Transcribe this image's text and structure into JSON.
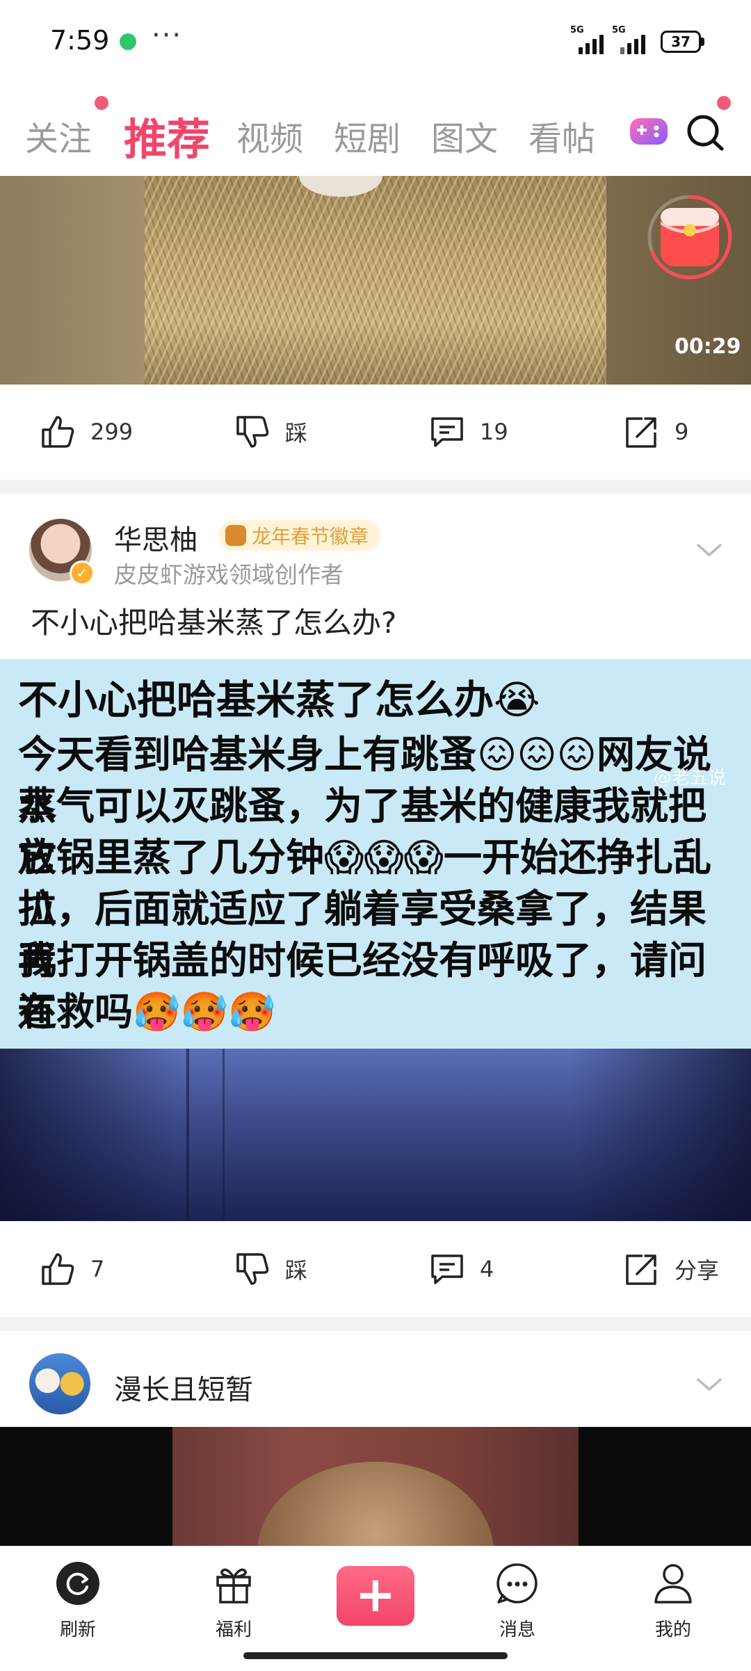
{
  "status_bar": {
    "time": "7:59",
    "more": "···",
    "net1": "5G",
    "net2": "5G",
    "battery": "37"
  },
  "tabs": [
    {
      "label": "关注"
    },
    {
      "label": "推荐"
    },
    {
      "label": "视频"
    },
    {
      "label": "短剧"
    },
    {
      "label": "图文"
    },
    {
      "label": "看帖"
    }
  ],
  "icons": {
    "game": "gamepad-icon",
    "search": "search-icon",
    "redpacket": "red-packet-icon"
  },
  "post1": {
    "video_duration": "00:29",
    "likes": "299",
    "dislike_label": "踩",
    "comments": "19",
    "shares": "9"
  },
  "post2": {
    "author": "华思柚",
    "badge": "龙年春节徽章",
    "author_desc": "皮皮虾游戏领域创作者",
    "title": "不小心把哈基米蒸了怎么办?",
    "image_title": "不小心把哈基米蒸了怎么办😭",
    "image_lines": [
      "今天看到哈基米身上有跳蚤😖😖😖网友说水",
      "蒸气可以灭跳蚤，为了基米的健康我就把它",
      "放锅里蒸了几分钟😱😱😱一开始还挣扎乱扒",
      "拉，后面就适应了躺着享受桑拿了，结果我",
      "再打开锅盖的时候已经没有呼吸了，请问还",
      "有救吗🥵🥵🥵"
    ],
    "watermark": "@老五说",
    "likes": "7",
    "dislike_label": "踩",
    "comments": "4",
    "share_label": "分享"
  },
  "post3": {
    "author": "漫长且短暂"
  },
  "bottom_nav": [
    {
      "label": "刷新"
    },
    {
      "label": "福利"
    },
    {
      "label": "+"
    },
    {
      "label": "消息"
    },
    {
      "label": "我的"
    }
  ],
  "colors": {
    "accent": "#f2456a",
    "inactive_tab": "#9a9a9a",
    "image_panel_bg": "#c9e9f6"
  }
}
